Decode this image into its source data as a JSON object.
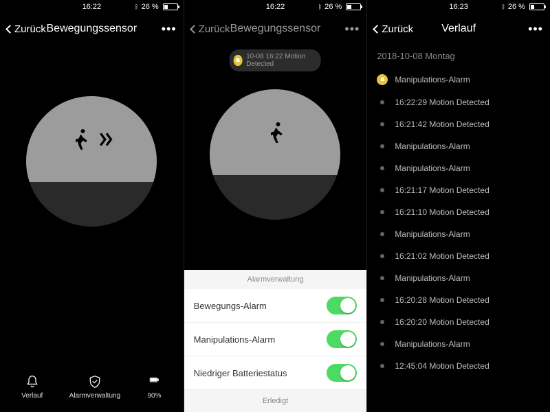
{
  "statusbar": {
    "time1": "16:22",
    "time2": "16:22",
    "time3": "16:23",
    "battery_pct": "26 %"
  },
  "nav": {
    "back": "Zurück",
    "title_sensor": "Bewegungssensor",
    "title_history": "Verlauf"
  },
  "screen1": {
    "tabs": {
      "history": "Verlauf",
      "alarm": "Alarmverwaltung",
      "battery": "90%"
    }
  },
  "screen2": {
    "toast": "10-08 16:22 Motion Detected",
    "sheet_title": "Alarmverwaltung",
    "rows": [
      {
        "label": "Bewegungs-Alarm"
      },
      {
        "label": "Manipulations-Alarm"
      },
      {
        "label": "Niedriger Batteriestatus"
      }
    ],
    "done": "Erledigt"
  },
  "screen3": {
    "date": "2018-10-08  Montag",
    "items": [
      {
        "label": "Manipulations-Alarm",
        "highlight": true
      },
      {
        "label": "16:22:29 Motion Detected"
      },
      {
        "label": "16:21:42 Motion Detected"
      },
      {
        "label": "Manipulations-Alarm"
      },
      {
        "label": "Manipulations-Alarm"
      },
      {
        "label": "16:21:17 Motion Detected"
      },
      {
        "label": "16:21:10 Motion Detected"
      },
      {
        "label": "Manipulations-Alarm"
      },
      {
        "label": "16:21:02 Motion Detected"
      },
      {
        "label": "Manipulations-Alarm"
      },
      {
        "label": "16:20:28 Motion Detected"
      },
      {
        "label": "16:20:20 Motion Detected"
      },
      {
        "label": "Manipulations-Alarm"
      },
      {
        "label": "12:45:04 Motion Detected"
      }
    ]
  }
}
